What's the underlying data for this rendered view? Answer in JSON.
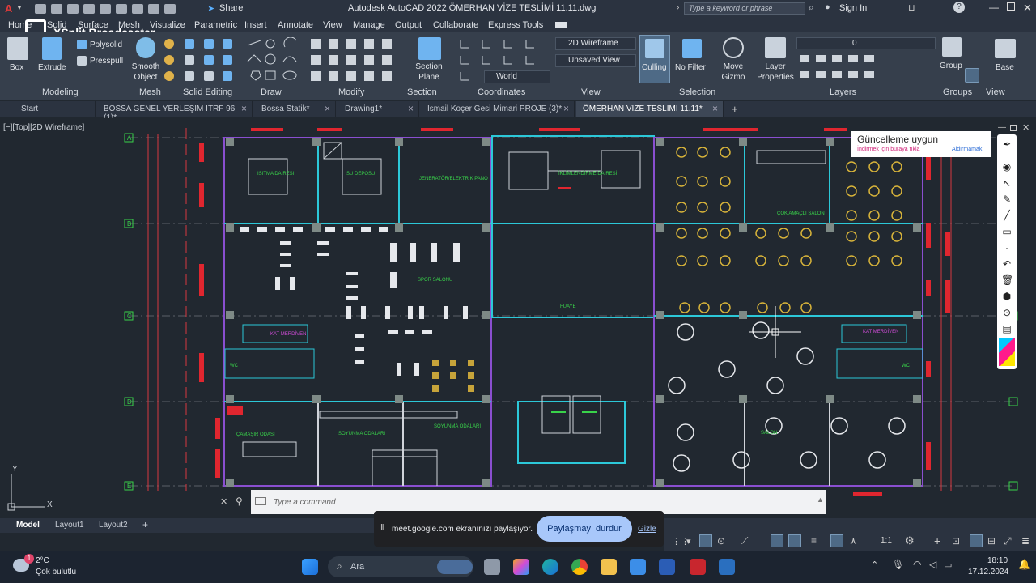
{
  "window": {
    "title": "Autodesk AutoCAD 2022   ÖMERHAN VİZE TESLİMİ 11.11.dwg",
    "share_label": "Share",
    "search_placeholder": "Type a keyword or phrase",
    "sign_in": "Sign In"
  },
  "overlay": {
    "xsplit_label": "XSplit Broadcaster"
  },
  "ribbon_tabs": [
    "Home",
    "Solid",
    "Surface",
    "Mesh",
    "Visualize",
    "Parametric",
    "Insert",
    "Annotate",
    "View",
    "Manage",
    "Output",
    "Collaborate",
    "Express Tools"
  ],
  "ribbon": {
    "modeling": {
      "label": "Modeling",
      "box": "Box",
      "extrude": "Extrude",
      "polysolid": "Polysolid",
      "presspull": "Presspull"
    },
    "mesh": {
      "label": "Mesh",
      "smooth_object": "Smooth Object"
    },
    "solid_editing": {
      "label": "Solid Editing"
    },
    "draw": {
      "label": "Draw"
    },
    "modify": {
      "label": "Modify"
    },
    "section": {
      "label": "Section",
      "section_plane": "Section Plane"
    },
    "coordinates": {
      "label": "Coordinates",
      "ucs_world": "World"
    },
    "view": {
      "label": "View",
      "visual_style": "2D Wireframe",
      "saved_view": "Unsaved View"
    },
    "selection": {
      "label": "Selection",
      "culling": "Culling",
      "no_filter": "No Filter",
      "move_gizmo": "Move Gizmo"
    },
    "layers": {
      "label": "Layers",
      "layer_properties": "Layer Properties",
      "current_layer": "0"
    },
    "groups": {
      "label": "Groups",
      "group": "Group"
    },
    "view2": {
      "label": "View",
      "base": "Base"
    }
  },
  "doc_tabs": [
    {
      "label": "Start",
      "active": false
    },
    {
      "label": "BOSSA GENEL YERLEŞİM ITRF 96 (1)*",
      "active": false
    },
    {
      "label": "Bossa Statik*",
      "active": false
    },
    {
      "label": "Drawing1*",
      "active": false
    },
    {
      "label": "İsmail Koçer Gesi Mimari PROJE (3)*",
      "active": false
    },
    {
      "label": "ÖMERHAN VİZE TESLİMİ 11.11*",
      "active": true
    }
  ],
  "viewport": {
    "label": "[−][Top][2D Wireframe]",
    "grid_labels": [
      "A",
      "B",
      "C",
      "D",
      "E"
    ],
    "rooms": [
      "ISITMA DAIRESI",
      "SU DEPOSU",
      "JENERATÖR/ELEKTRİK PANO",
      "İKLİMLENDİRME DAİRESİ",
      "ÇOK AMAÇLI SALON",
      "SPOR SALONU",
      "FUAYE",
      "KAT MERDİVEN",
      "KAT MERDİVEN",
      "WC",
      "WC",
      "ÇAMAŞIR ODASI",
      "SOYUNMA ODALARI",
      "SOYUNMA ODALARI",
      "SALON"
    ]
  },
  "notification": {
    "title": "Güncelleme uygun",
    "subtitle": "İndirmek için buraya tıkla",
    "dismiss": "Aldırmamak"
  },
  "command": {
    "placeholder": "Type a command"
  },
  "layout_tabs": [
    "Model",
    "Layout1",
    "Layout2"
  ],
  "screen_share": {
    "message": "meet.google.com ekranınızı paylaşıyor.",
    "stop_label": "Paylaşmayı durdur",
    "hide_label": "Gizle"
  },
  "status": {
    "scale": "1:1"
  },
  "taskbar": {
    "weather_temp": "2°C",
    "weather_desc": "Çok bulutlu",
    "weather_badge": "1",
    "search_label": "Ara",
    "time": "18:10",
    "date": "17.12.2024"
  }
}
